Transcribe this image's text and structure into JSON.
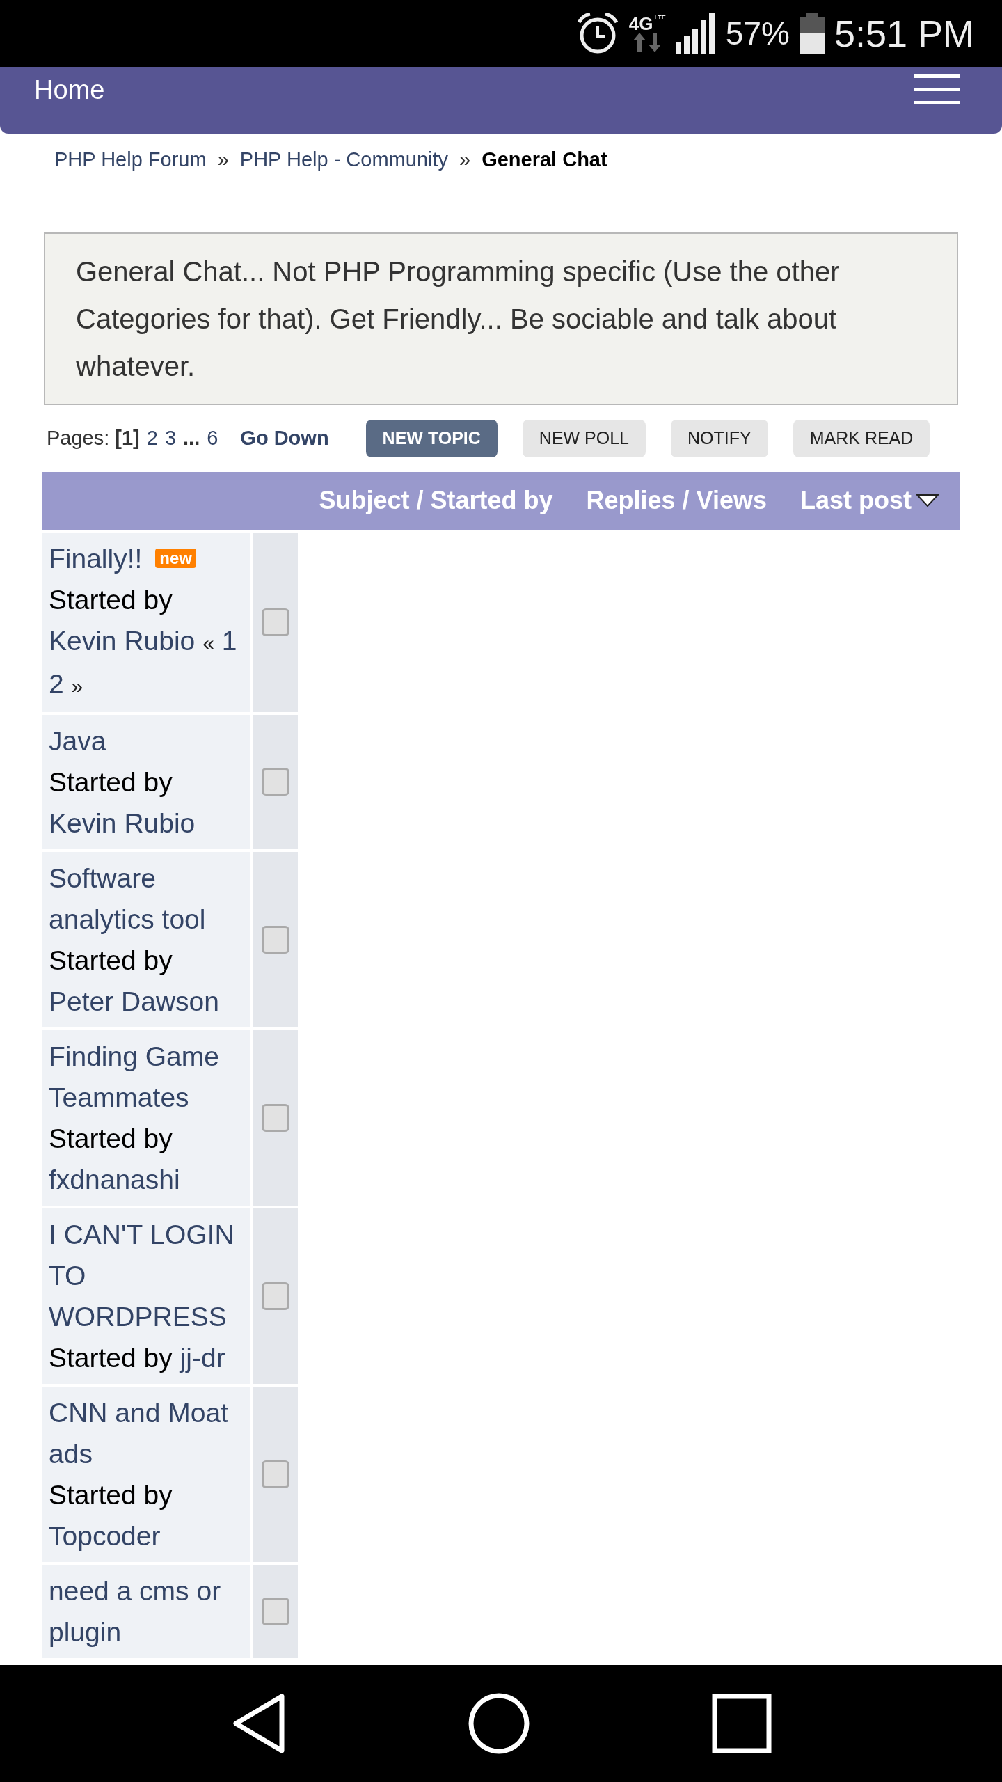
{
  "status_bar": {
    "network": "4G",
    "network_sub": "LTE",
    "battery": "57%",
    "time": "5:51 PM"
  },
  "header": {
    "title": "Home"
  },
  "breadcrumb": [
    {
      "label": "PHP Help Forum",
      "current": false
    },
    {
      "label": "PHP Help - Community",
      "current": false
    },
    {
      "label": "General Chat",
      "current": true
    }
  ],
  "separator": "»",
  "description": "General Chat... Not PHP Programming specific (Use the other Categories for that). Get Friendly... Be sociable and talk about whatever.",
  "pagination": {
    "label": "Pages:",
    "pages": [
      {
        "label": "[1]",
        "kind": "current"
      },
      {
        "label": "2",
        "kind": "link"
      },
      {
        "label": "3",
        "kind": "link"
      },
      {
        "label": "...",
        "kind": "gap"
      },
      {
        "label": "6",
        "kind": "link"
      }
    ],
    "go_down": "Go Down"
  },
  "buttons": [
    {
      "label": "NEW TOPIC",
      "selected": true
    },
    {
      "label": "NEW POLL",
      "selected": false
    },
    {
      "label": "NOTIFY",
      "selected": false
    },
    {
      "label": "MARK READ",
      "selected": false
    }
  ],
  "table": {
    "columns": [
      "Subject / Started by",
      "Replies / Views",
      "Last post"
    ],
    "rows": [
      {
        "subject": "Finally!!",
        "badge": "new",
        "started_by": "Started by",
        "author": "Kevin Rubio",
        "pages_open": "«",
        "pages": [
          "1",
          "2"
        ],
        "pages_close": "»",
        "checked": false
      },
      {
        "subject": "Java",
        "started_by": "Started by",
        "author": "Kevin Rubio",
        "checked": false
      },
      {
        "subject": "Software analytics tool",
        "started_by": "Started by",
        "author": "Peter Dawson",
        "checked": false
      },
      {
        "subject": "Finding Game Teammates",
        "started_by": "Started by",
        "author": "fxdnanashi",
        "checked": false
      },
      {
        "subject": "I CAN'T LOGIN TO WORDPRESS",
        "started_by": "Started by",
        "author": "jj-dr",
        "checked": false
      },
      {
        "subject": "CNN and Moat ads",
        "started_by": "Started by",
        "author": "Topcoder",
        "checked": false
      },
      {
        "subject": "need a cms or plugin",
        "checked": false
      }
    ]
  }
}
